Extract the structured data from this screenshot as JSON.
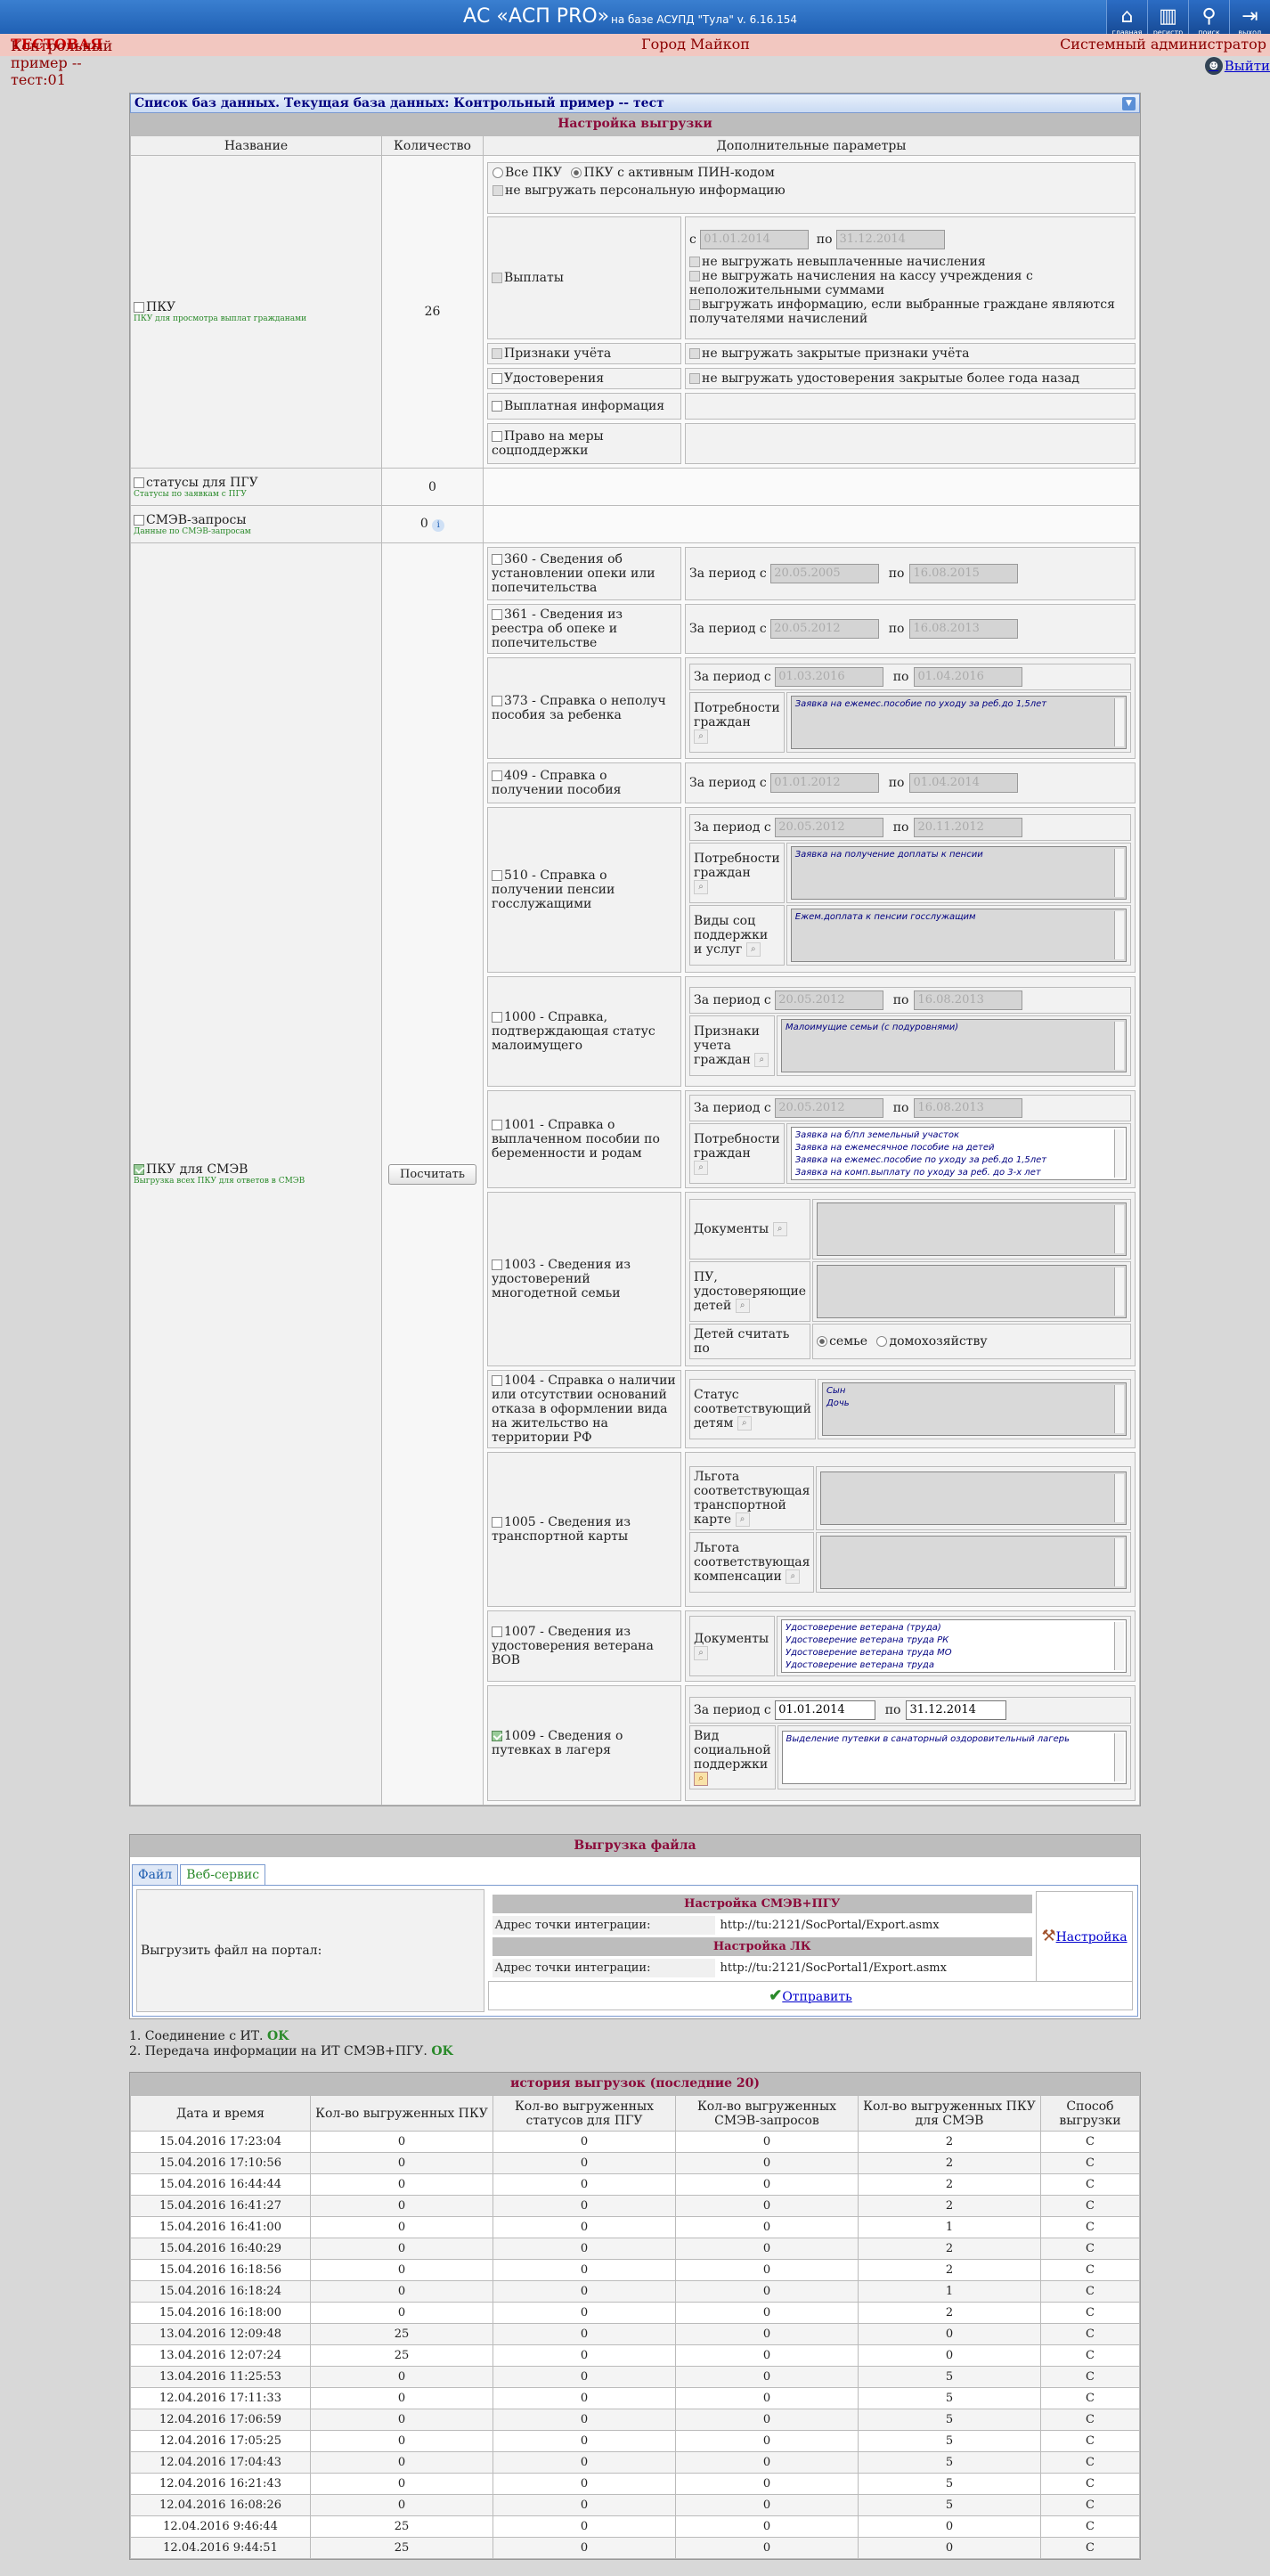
{
  "header": {
    "title": "АС «АСП PRO»",
    "subtitle": "на базе АСУПД \"Тула\"   v. 6.16.154",
    "icons": [
      {
        "label": "главная",
        "icon": "home-icon"
      },
      {
        "label": "регистр",
        "icon": "registry-icon"
      },
      {
        "label": "поиск",
        "icon": "search-icon"
      },
      {
        "label": "выход",
        "icon": "exit-icon"
      }
    ]
  },
  "infobar": {
    "left": "Контрольный пример -- тест:01",
    "left_tag": "ТЕСТОВАЯ",
    "center": "Город Майкоп",
    "right": "Системный администратор",
    "exit": "Выйти"
  },
  "dbpanel": {
    "title": "Список баз данных. Текущая база данных: Контрольный пример -- тест"
  },
  "config": {
    "title": "Настройка выгрузки",
    "columns": [
      "Название",
      "Количество",
      "Дополнительные параметры"
    ],
    "pku": {
      "label": "ПКУ",
      "sub": "ПКУ для просмотра выплат гражданами",
      "count": "26",
      "radio_all": "Все ПКУ",
      "radio_active": "ПКУ с активным ПИН-кодом",
      "no_personal": "не выгружать персональную информацию",
      "payments": "Выплаты",
      "from": "с",
      "to": "по",
      "date_from": "01.01.2014",
      "date_to": "31.12.2014",
      "opt1": "не выгружать невыплаченные начисления",
      "opt2": "не выгружать начисления на кассу учреждения с неположительными суммами",
      "opt3": "выгружать информацию, если выбранные граждане являются получателями начислений",
      "accounting": "Признаки учёта",
      "accounting_opt": "не выгружать закрытые признаки учёта",
      "certificates": "Удостоверения",
      "certificates_opt": "не выгружать удостоверения закрытые более года назад",
      "payinfo": "Выплатная информация",
      "rights": "Право на меры соцподдержки"
    },
    "statuses": {
      "label": "статусы для ПГУ",
      "sub": "Статусы по заявкам с ПГУ",
      "count": "0"
    },
    "smev": {
      "label": "СМЭВ-запросы",
      "sub": "Данные по СМЭВ-запросам",
      "count": "0",
      "info": "i"
    },
    "pku_smev": {
      "label": "ПКУ для СМЭВ",
      "sub": "Выгрузка всех ПКУ для ответов в СМЭВ",
      "count_button": "Посчитать",
      "period_label": "За период с",
      "to": "по",
      "reports": [
        {
          "name": "360 - Сведения об установлении опеки или попечительства",
          "from": "20.05.2005",
          "to": "16.08.2015"
        },
        {
          "name": "361 - Сведения из реестра об опеке и попечительстве",
          "from": "20.05.2012",
          "to": "16.08.2013"
        },
        {
          "name": "373 - Справка о неполуч пособия за ребенка",
          "from": "01.03.2016",
          "to": "01.04.2016",
          "list_label": "Потребности граждан",
          "list": [
            "Заявка на ежемес.пособие по уходу за реб.до 1,5лет"
          ]
        },
        {
          "name": "409 - Справка о получении пособия",
          "from": "01.01.2012",
          "to": "01.04.2014"
        },
        {
          "name": "510 - Справка о получении пенсии госслужащими",
          "from": "20.05.2012",
          "to": "20.11.2012",
          "list_label": "Потребности граждан",
          "list": [
            "Заявка на получение доплаты к пенсии"
          ],
          "list2_label": "Виды соц поддержки и услуг",
          "list2": [
            "Ежем.доплата к пенсии госслужащим"
          ]
        },
        {
          "name": "1000 - Справка, подтверждающая статус малоимущего",
          "from": "20.05.2012",
          "to": "16.08.2013",
          "list_label": "Признаки учета граждан",
          "list": [
            "Малоимущие семьи (с подуровнями)"
          ]
        },
        {
          "name": "1001 - Справка о выплаченном пособии по беременности и родам",
          "from": "20.05.2012",
          "to": "16.08.2013",
          "list_label": "Потребности граждан",
          "list": [
            "Заявка на б/пл земельный участок",
            "Заявка на ежемесячное пособие на детей",
            "Заявка на ежемес.пособие по уходу за реб.до 1,5лет",
            "Заявка на комп.выплату по уходу за реб. до 3-х лет"
          ]
        },
        {
          "name": "1003 - Сведения из удостоверений многодетной семьи",
          "docs_label": "Документы",
          "pu_label": "ПУ, удостоверяющие детей",
          "count_label": "Детей считать по",
          "radio1": "семье",
          "radio2": "домохозяйству"
        },
        {
          "name": "1004 - Справка о наличии или отсутствии оснований отказа в оформлении вида на жительство на территории РФ",
          "list_label": "Статус соответствующий детям",
          "list": [
            "Сын",
            "Дочь"
          ]
        },
        {
          "name": "1005 - Сведения из транспортной карты",
          "list_label": "Льгота соответствующая транспортной карте",
          "list2_label": "Льгота соответствующая компенсации"
        },
        {
          "name": "1007 - Сведения из удостоверения ветерана ВОВ",
          "list_label": "Документы",
          "list": [
            "Удостоверение ветерана (труда)",
            "Удостоверение ветерана труда РК",
            "Удостоверение ветерана труда МО",
            "Удостоверение ветерана труда"
          ]
        },
        {
          "name": "1009 - Сведения о путевках в лагеря",
          "from": "01.01.2014",
          "to": "31.12.2014",
          "list_label": "Вид социальной поддержки",
          "list": [
            "Выделение путевки в санаторный оздоровительный лагерь"
          ]
        }
      ]
    }
  },
  "upload": {
    "title": "Выгрузка файла",
    "tab_file": "Файл",
    "tab_web": "Веб-сервис",
    "portal_label": "Выгрузить файл на портал:",
    "smev_title": "Настройка СМЭВ+ПГУ",
    "addr_label": "Адрес точки интеграции:",
    "smev_addr": "http://tu:2121/SocPortal/Export.asmx",
    "lk_title": "Настройка ЛК",
    "lk_addr": "http://tu:2121/SocPortal1/Export.asmx",
    "settings": "Настройка",
    "send": "Отправить"
  },
  "status": {
    "line1": "1. Соединение с ИТ.",
    "line2": "2. Передача информации на ИТ СМЭВ+ПГУ.",
    "ok": "OK"
  },
  "history": {
    "title": "история выгрузок (последние 20)",
    "columns": [
      "Дата и время",
      "Кол-во выгруженных ПКУ",
      "Кол-во выгруженных статусов для ПГУ",
      "Кол-во выгруженных СМЭВ-запросов",
      "Кол-во выгруженных ПКУ для СМЭВ",
      "Способ выгрузки"
    ],
    "rows": [
      [
        "15.04.2016 17:23:04",
        "0",
        "0",
        "0",
        "2",
        "C"
      ],
      [
        "15.04.2016 17:10:56",
        "0",
        "0",
        "0",
        "2",
        "C"
      ],
      [
        "15.04.2016 16:44:44",
        "0",
        "0",
        "0",
        "2",
        "C"
      ],
      [
        "15.04.2016 16:41:27",
        "0",
        "0",
        "0",
        "2",
        "C"
      ],
      [
        "15.04.2016 16:41:00",
        "0",
        "0",
        "0",
        "1",
        "C"
      ],
      [
        "15.04.2016 16:40:29",
        "0",
        "0",
        "0",
        "2",
        "C"
      ],
      [
        "15.04.2016 16:18:56",
        "0",
        "0",
        "0",
        "2",
        "C"
      ],
      [
        "15.04.2016 16:18:24",
        "0",
        "0",
        "0",
        "1",
        "C"
      ],
      [
        "15.04.2016 16:18:00",
        "0",
        "0",
        "0",
        "2",
        "C"
      ],
      [
        "13.04.2016 12:09:48",
        "25",
        "0",
        "0",
        "0",
        "C"
      ],
      [
        "13.04.2016 12:07:24",
        "25",
        "0",
        "0",
        "0",
        "C"
      ],
      [
        "13.04.2016 11:25:53",
        "0",
        "0",
        "0",
        "5",
        "C"
      ],
      [
        "12.04.2016 17:11:33",
        "0",
        "0",
        "0",
        "5",
        "C"
      ],
      [
        "12.04.2016 17:06:59",
        "0",
        "0",
        "0",
        "5",
        "C"
      ],
      [
        "12.04.2016 17:05:25",
        "0",
        "0",
        "0",
        "5",
        "C"
      ],
      [
        "12.04.2016 17:04:43",
        "0",
        "0",
        "0",
        "5",
        "C"
      ],
      [
        "12.04.2016 16:21:43",
        "0",
        "0",
        "0",
        "5",
        "C"
      ],
      [
        "12.04.2016 16:08:26",
        "0",
        "0",
        "0",
        "5",
        "C"
      ],
      [
        "12.04.2016 9:46:44",
        "25",
        "0",
        "0",
        "0",
        "C"
      ],
      [
        "12.04.2016 9:44:51",
        "25",
        "0",
        "0",
        "0",
        "C"
      ]
    ]
  }
}
